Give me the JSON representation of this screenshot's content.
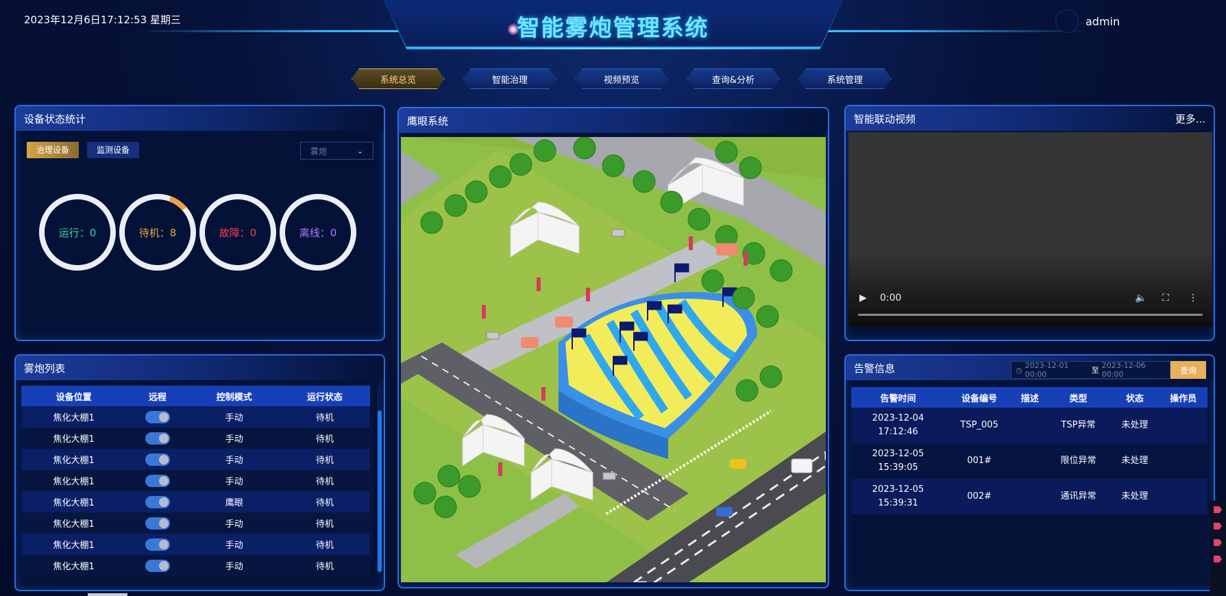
{
  "header": {
    "datetime": "2023年12月6日17:12:53 星期三",
    "title": "智能雾炮管理系统",
    "user": "admin"
  },
  "nav": {
    "tabs": [
      {
        "label": "系统总览",
        "active": true
      },
      {
        "label": "智能治理",
        "active": false
      },
      {
        "label": "视频预览",
        "active": false
      },
      {
        "label": "查询&分析",
        "active": false
      },
      {
        "label": "系统管理",
        "active": false
      }
    ]
  },
  "device_status": {
    "title": "设备状态统计",
    "toggle_active": "治理设备",
    "toggle_inactive": "监测设备",
    "select_value": "雾炮",
    "stats": [
      {
        "label": "运行：0",
        "color": "#3fd6a5",
        "fraction": 0
      },
      {
        "label": "待机：8",
        "color": "#f0a040",
        "fraction": 0.08
      },
      {
        "label": "故障：0",
        "color": "#ff3a5a",
        "fraction": 0
      },
      {
        "label": "离线：0",
        "color": "#b07cff",
        "fraction": 0
      }
    ]
  },
  "cannon_list": {
    "title": "雾炮列表",
    "columns": [
      "设备位置",
      "远程",
      "控制模式",
      "运行状态"
    ],
    "rows": [
      {
        "location": "焦化大棚1",
        "remote": true,
        "mode": "手动",
        "status": "待机"
      },
      {
        "location": "焦化大棚1",
        "remote": true,
        "mode": "手动",
        "status": "待机"
      },
      {
        "location": "焦化大棚1",
        "remote": true,
        "mode": "手动",
        "status": "待机"
      },
      {
        "location": "焦化大棚1",
        "remote": true,
        "mode": "手动",
        "status": "待机"
      },
      {
        "location": "焦化大棚1",
        "remote": true,
        "mode": "鹰眼",
        "status": "待机"
      },
      {
        "location": "焦化大棚1",
        "remote": true,
        "mode": "手动",
        "status": "待机"
      },
      {
        "location": "焦化大棚1",
        "remote": true,
        "mode": "手动",
        "status": "待机"
      },
      {
        "location": "焦化大棚1",
        "remote": true,
        "mode": "手动",
        "status": "待机"
      }
    ]
  },
  "eagle_eye": {
    "title": "鹰眼系统"
  },
  "video": {
    "title": "智能联动视频",
    "more": "更多...",
    "time": "0:00"
  },
  "alarms": {
    "title": "告警信息",
    "date_from": "2023-12-01 00:00",
    "date_sep": "至",
    "date_to": "2023-12-06 00:00",
    "query_label": "查询",
    "columns": [
      "告警时间",
      "设备编号",
      "描述",
      "类型",
      "状态",
      "操作员"
    ],
    "rows": [
      {
        "date": "2023-12-04",
        "time": "17:12:46",
        "device": "TSP_005",
        "desc": "",
        "type": "TSP异常",
        "state": "未处理",
        "operator": ""
      },
      {
        "date": "2023-12-05",
        "time": "15:39:05",
        "device": "001#",
        "desc": "",
        "type": "限位异常",
        "state": "未处理",
        "operator": ""
      },
      {
        "date": "2023-12-05",
        "time": "15:39:31",
        "device": "002#",
        "desc": "",
        "type": "通讯异常",
        "state": "未处理",
        "operator": ""
      }
    ]
  }
}
